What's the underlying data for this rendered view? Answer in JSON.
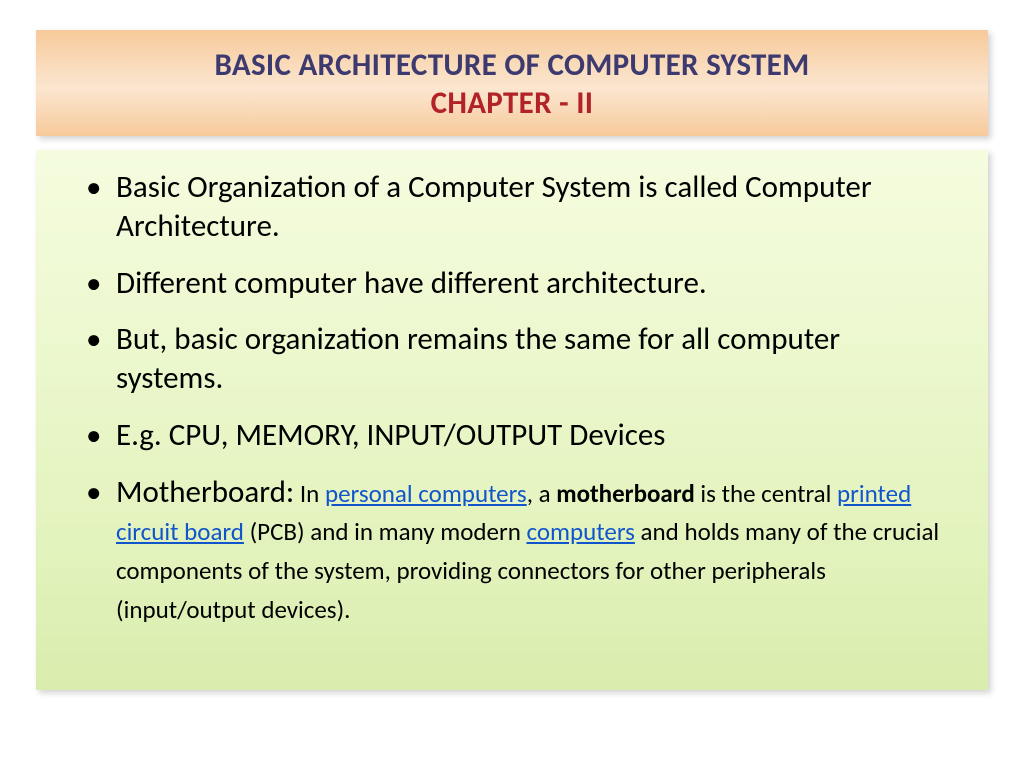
{
  "title": {
    "line1": "BASIC ARCHITECTURE OF COMPUTER SYSTEM",
    "line2": "CHAPTER - II"
  },
  "bullets": {
    "b1": "Basic Organization of a Computer System is called Computer Architecture.",
    "b2": "Different computer have different architecture.",
    "b3": "But, basic organization remains the same for all computer systems.",
    "b4": "E.g. CPU, MEMORY, INPUT/OUTPUT Devices",
    "b5": {
      "lead": "Motherboard:",
      "t1": " In ",
      "link1": "personal computers",
      "t2": ", a ",
      "bold1": "motherboard",
      "t3": " is the central ",
      "link2": "printed circuit board",
      "t4": " (PCB) and in many modern ",
      "link3": "computers",
      "t5": " and holds many of the crucial components of the system, providing connectors  for other peripherals (input/output devices)."
    }
  }
}
